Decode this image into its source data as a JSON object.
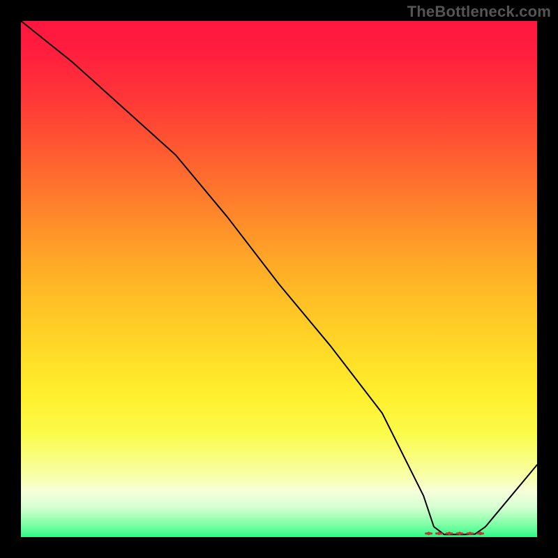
{
  "watermark": "TheBottleneck.com",
  "chart_data": {
    "type": "line",
    "title": "",
    "xlabel": "",
    "ylabel": "",
    "xlim": [
      0,
      100
    ],
    "ylim": [
      0,
      100
    ],
    "grid": false,
    "legend": false,
    "notes": "Gradient background red→yellow→green. Single black line descends from top-left, flattens near zero around x≈80–88, then rises. Small red dashed markers highlight the flat minimum segment.",
    "series": [
      {
        "name": "curve",
        "x": [
          0,
          10,
          20,
          30,
          40,
          50,
          60,
          70,
          78,
          80,
          82,
          84,
          86,
          88,
          90,
          95,
          100
        ],
        "values": [
          100,
          92,
          83,
          74,
          62,
          49,
          37,
          24,
          8,
          2,
          0.5,
          0.5,
          0.5,
          0.6,
          2,
          8,
          14
        ]
      }
    ],
    "marker_region": {
      "x_start": 79,
      "x_end": 89,
      "y": 0.7
    }
  },
  "colors": {
    "curve": "#000000",
    "markers": "#bb3a33"
  }
}
